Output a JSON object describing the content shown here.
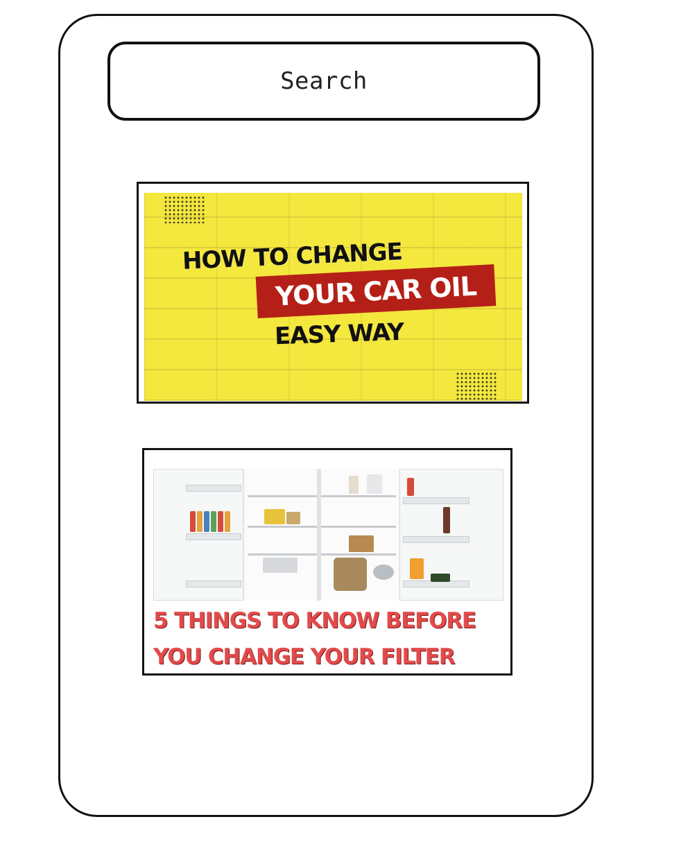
{
  "search": {
    "label": "Search"
  },
  "cards": [
    {
      "headline_line1": "HOW TO CHANGE",
      "headline_line2": "YOUR CAR OIL",
      "headline_line3": "EASY WAY",
      "background_color": "#f4e73e",
      "band_color": "#b42018"
    },
    {
      "caption_line1": "5 THINGS TO KNOW BEFORE",
      "caption_line2": "YOU CHANGE YOUR FILTER",
      "caption_color": "#e34a4a",
      "image_subject": "open refrigerator"
    }
  ]
}
